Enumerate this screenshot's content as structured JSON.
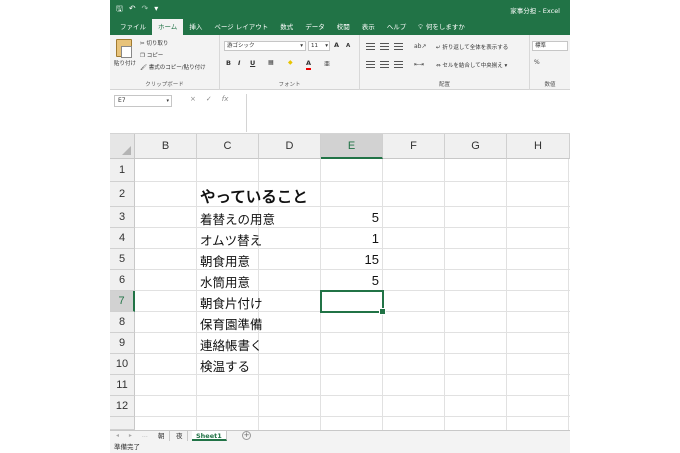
{
  "window": {
    "title": "家事分担 - Excel"
  },
  "qat": {
    "save": "🖫",
    "undo": "↶",
    "redo": "↷",
    "more": "▾"
  },
  "ribbon_tabs": [
    "ファイル",
    "ホーム",
    "挿入",
    "ページ レイアウト",
    "数式",
    "データ",
    "校閲",
    "表示",
    "ヘルプ"
  ],
  "tell_me": "何をしますか",
  "ribbon": {
    "clipboard": {
      "paste": "貼り付け",
      "cut": "切り取り",
      "copy": "コピー",
      "format_painter": "書式のコピー/貼り付け",
      "label": "クリップボード"
    },
    "font": {
      "name": "游ゴシック",
      "size": "11",
      "grow": "A",
      "shrink": "A",
      "bold": "B",
      "italic": "I",
      "underline": "U",
      "font_color": "A",
      "label": "フォント"
    },
    "alignment": {
      "wrap_text": "折り返して全体を表示する",
      "merge_center": "セルを結合して中央揃え",
      "label": "配置"
    },
    "number": {
      "format": "標準",
      "percent": "%",
      "label": "数値"
    }
  },
  "formula_bar": {
    "name_box": "E7",
    "cancel": "×",
    "enter": "✓",
    "fx": "fx",
    "formula": ""
  },
  "columns": [
    "B",
    "C",
    "D",
    "E",
    "F",
    "G",
    "H"
  ],
  "selected_column": "E",
  "rows": [
    "1",
    "2",
    "3",
    "4",
    "5",
    "6",
    "7",
    "8",
    "9",
    "10",
    "11",
    "12"
  ],
  "selected_row": "7",
  "cells": {
    "C2": "やっていること",
    "C3": "着替えの用意",
    "C4": "オムツ替え",
    "C5": "朝食用意",
    "C6": "水筒用意",
    "C7": "朝食片付け",
    "C8": "保育園準備",
    "C9": "連絡帳書く",
    "C10": "検温する",
    "E3": "5",
    "E4": "1",
    "E5": "15",
    "E6": "5"
  },
  "sheets": [
    "朝",
    "夜",
    "Sheet1"
  ],
  "active_sheet": "Sheet1",
  "status": "準備完了",
  "colors": {
    "excel_green": "#217346"
  }
}
